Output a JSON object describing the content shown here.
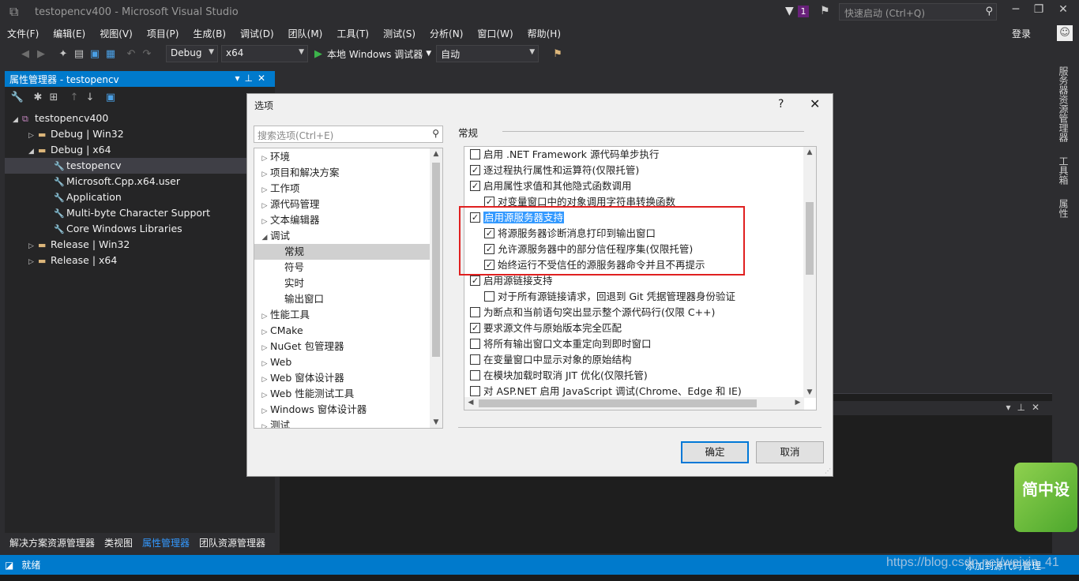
{
  "window": {
    "title": "testopencv400 - Microsoft Visual Studio",
    "notif_count": "1",
    "quick_launch_placeholder": "快速启动 (Ctrl+Q)",
    "login": "登录"
  },
  "menu": [
    "文件(F)",
    "编辑(E)",
    "视图(V)",
    "项目(P)",
    "生成(B)",
    "调试(D)",
    "团队(M)",
    "工具(T)",
    "测试(S)",
    "分析(N)",
    "窗口(W)",
    "帮助(H)"
  ],
  "toolbar": {
    "config": "Debug",
    "platform": "x64",
    "run_label": "本地 Windows 调试器",
    "auto": "自动"
  },
  "prop_panel": {
    "title": "属性管理器 - testopencv",
    "tree": [
      {
        "label": "testopencv400"
      },
      {
        "label": "Debug | Win32"
      },
      {
        "label": "Debug | x64"
      },
      {
        "label": "testopencv"
      },
      {
        "label": "Microsoft.Cpp.x64.user"
      },
      {
        "label": "Application"
      },
      {
        "label": "Multi-byte Character Support"
      },
      {
        "label": "Core Windows Libraries"
      },
      {
        "label": "Release | Win32"
      },
      {
        "label": "Release | x64"
      }
    ]
  },
  "bottom_tabs": [
    "解决方案资源管理器",
    "类视图",
    "属性管理器",
    "团队资源管理器"
  ],
  "side_tabs": [
    "服务器资源管理器",
    "工具箱",
    "属性"
  ],
  "status": {
    "text": "就绪",
    "right": "添加到源代码管理",
    "watermark": "https://blog.csdn.net/weixin_41"
  },
  "widget_text": "简中设",
  "dialog": {
    "title": "选项",
    "help": "?",
    "search_placeholder": "搜索选项(Ctrl+E)",
    "section": "常规",
    "nav": [
      {
        "label": "环境"
      },
      {
        "label": "项目和解决方案"
      },
      {
        "label": "工作项"
      },
      {
        "label": "源代码管理"
      },
      {
        "label": "文本编辑器"
      },
      {
        "label": "调试"
      },
      {
        "label": "常规"
      },
      {
        "label": "符号"
      },
      {
        "label": "实时"
      },
      {
        "label": "输出窗口"
      },
      {
        "label": "性能工具"
      },
      {
        "label": "CMake"
      },
      {
        "label": "NuGet 包管理器"
      },
      {
        "label": "Web"
      },
      {
        "label": "Web 窗体设计器"
      },
      {
        "label": "Web 性能测试工具"
      },
      {
        "label": "Windows 窗体设计器"
      },
      {
        "label": "测试"
      }
    ],
    "options": [
      {
        "label": "启用 .NET Framework 源代码单步执行",
        "checked": false
      },
      {
        "label": "逐过程执行属性和运算符(仅限托管)",
        "checked": true
      },
      {
        "label": "启用属性求值和其他隐式函数调用",
        "checked": true
      },
      {
        "label": "对变量窗口中的对象调用字符串转换函数",
        "checked": true
      },
      {
        "label": "启用源服务器支持",
        "checked": true
      },
      {
        "label": "将源服务器诊断消息打印到输出窗口",
        "checked": true
      },
      {
        "label": "允许源服务器中的部分信任程序集(仅限托管)",
        "checked": true
      },
      {
        "label": "始终运行不受信任的源服务器命令并且不再提示",
        "checked": true
      },
      {
        "label": "启用源链接支持",
        "checked": true
      },
      {
        "label": "对于所有源链接请求，回退到 Git 凭据管理器身份验证",
        "checked": false
      },
      {
        "label": "为断点和当前语句突出显示整个源代码行(仅限 C++)",
        "checked": false
      },
      {
        "label": "要求源文件与原始版本完全匹配",
        "checked": true
      },
      {
        "label": "将所有输出窗口文本重定向到即时窗口",
        "checked": false
      },
      {
        "label": "在变量窗口中显示对象的原始结构",
        "checked": false
      },
      {
        "label": "在模块加载时取消 JIT 优化(仅限托管)",
        "checked": false
      },
      {
        "label": "对 ASP.NET 启用 JavaScript 调试(Chrome、Edge 和 IE)",
        "checked": false
      }
    ],
    "ok": "确定",
    "cancel": "取消"
  }
}
